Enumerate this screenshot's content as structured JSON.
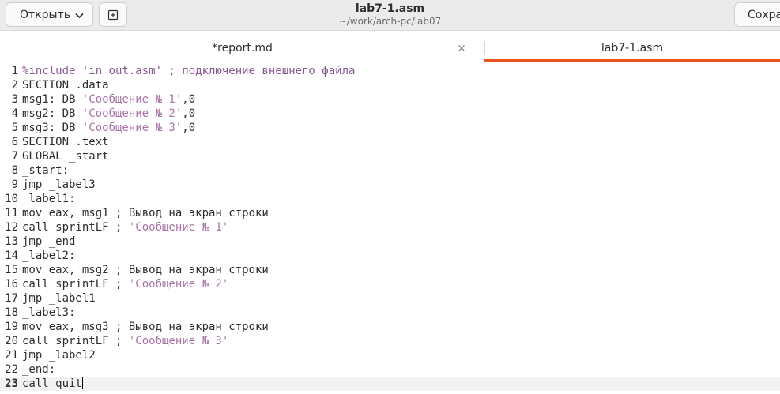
{
  "header": {
    "open_label": "Открыть",
    "save_label": "Сохра",
    "title": "lab7-1.asm",
    "subtitle": "~/work/arch-pc/lab07"
  },
  "tabs": [
    {
      "label": "*report.md",
      "active": false
    },
    {
      "label": "lab7-1.asm",
      "active": true
    }
  ],
  "editor": {
    "current_line": 23,
    "lines": [
      {
        "n": "1",
        "parts": [
          {
            "t": "%include 'in_out.asm' ; подключение внешнего файла",
            "c": "preproc"
          }
        ]
      },
      {
        "n": "2",
        "parts": [
          {
            "t": "SECTION .data",
            "c": ""
          }
        ]
      },
      {
        "n": "3",
        "parts": [
          {
            "t": "msg1: DB ",
            "c": ""
          },
          {
            "t": "'Сообщение № 1'",
            "c": "str"
          },
          {
            "t": ",0",
            "c": ""
          }
        ]
      },
      {
        "n": "4",
        "parts": [
          {
            "t": "msg2: DB ",
            "c": ""
          },
          {
            "t": "'Сообщение № 2'",
            "c": "str"
          },
          {
            "t": ",0",
            "c": ""
          }
        ]
      },
      {
        "n": "5",
        "parts": [
          {
            "t": "msg3: DB ",
            "c": ""
          },
          {
            "t": "'Сообщение № 3'",
            "c": "str"
          },
          {
            "t": ",0",
            "c": ""
          }
        ]
      },
      {
        "n": "6",
        "parts": [
          {
            "t": "SECTION .text",
            "c": ""
          }
        ]
      },
      {
        "n": "7",
        "parts": [
          {
            "t": "GLOBAL _start",
            "c": ""
          }
        ]
      },
      {
        "n": "8",
        "parts": [
          {
            "t": "_start:",
            "c": ""
          }
        ]
      },
      {
        "n": "9",
        "parts": [
          {
            "t": "jmp _label3",
            "c": ""
          }
        ]
      },
      {
        "n": "10",
        "parts": [
          {
            "t": "_label1:",
            "c": ""
          }
        ]
      },
      {
        "n": "11",
        "parts": [
          {
            "t": "mov eax, msg1 ; Вывод на экран строки",
            "c": ""
          }
        ]
      },
      {
        "n": "12",
        "parts": [
          {
            "t": "call sprintLF ; ",
            "c": ""
          },
          {
            "t": "'Сообщение № 1'",
            "c": "str"
          }
        ]
      },
      {
        "n": "13",
        "parts": [
          {
            "t": "jmp _end",
            "c": ""
          }
        ]
      },
      {
        "n": "14",
        "parts": [
          {
            "t": "_label2:",
            "c": ""
          }
        ]
      },
      {
        "n": "15",
        "parts": [
          {
            "t": "mov eax, msg2 ; Вывод на экран строки",
            "c": ""
          }
        ]
      },
      {
        "n": "16",
        "parts": [
          {
            "t": "call sprintLF ; ",
            "c": ""
          },
          {
            "t": "'Сообщение № 2'",
            "c": "str"
          }
        ]
      },
      {
        "n": "17",
        "parts": [
          {
            "t": "jmp _label1",
            "c": ""
          }
        ]
      },
      {
        "n": "18",
        "parts": [
          {
            "t": "_label3:",
            "c": ""
          }
        ]
      },
      {
        "n": "19",
        "parts": [
          {
            "t": "mov eax, msg3 ; Вывод на экран строки",
            "c": ""
          }
        ]
      },
      {
        "n": "20",
        "parts": [
          {
            "t": "call sprintLF ; ",
            "c": ""
          },
          {
            "t": "'Сообщение № 3'",
            "c": "str"
          }
        ]
      },
      {
        "n": "21",
        "parts": [
          {
            "t": "jmp _label2",
            "c": ""
          }
        ]
      },
      {
        "n": "22",
        "parts": [
          {
            "t": "_end:",
            "c": ""
          }
        ]
      },
      {
        "n": "23",
        "parts": [
          {
            "t": "call quit",
            "c": ""
          }
        ]
      }
    ]
  },
  "colors": {
    "accent": "#e95420",
    "string": "#a874a6",
    "preprocessor": "#8a5694",
    "text": "#2e2e2e"
  }
}
